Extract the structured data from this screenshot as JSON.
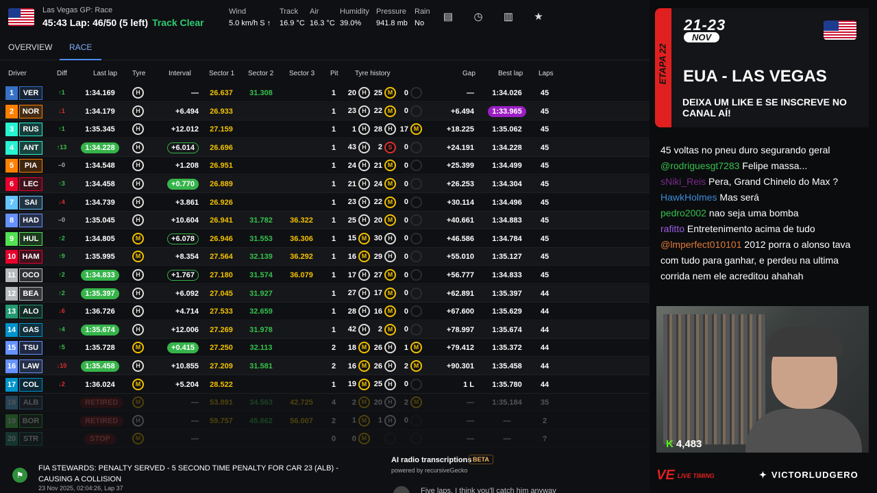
{
  "header": {
    "session": "Las Vegas GP: Race",
    "lap_line": "45:43 Lap: 46/50 (5 left)",
    "track_status": "Track Clear",
    "weather": [
      {
        "label": "Wind",
        "value": "5.0 km/h S ↑"
      },
      {
        "label": "Track",
        "value": "16.9 °C"
      },
      {
        "label": "Air",
        "value": "16.3 °C"
      },
      {
        "label": "Humidity",
        "value": "39.0%"
      },
      {
        "label": "Pressure",
        "value": "941.8 mb"
      },
      {
        "label": "Rain",
        "value": "No"
      }
    ]
  },
  "tabs": [
    {
      "label": "OVERVIEW"
    },
    {
      "label": "RACE",
      "active": true
    }
  ],
  "columns": {
    "driver": "Driver",
    "diff": "Diff",
    "last": "Last lap",
    "tyre": "Tyre",
    "interval": "Interval",
    "s1": "Sector 1",
    "s2": "Sector 2",
    "s3": "Sector 3",
    "pit": "Pit",
    "history": "Tyre history",
    "gap": "Gap",
    "best": "Best lap",
    "laps": "Laps"
  },
  "team_colors": {
    "VER": "#3671c6",
    "NOR": "#ff8000",
    "RUS": "#27f4d2",
    "ANT": "#27f4d2",
    "PIA": "#ff8000",
    "LEC": "#e8002d",
    "SAI": "#64c4ff",
    "HAD": "#6692ff",
    "HUL": "#52e252",
    "HAM": "#e8002d",
    "OCO": "#b6babd",
    "BEA": "#b6babd",
    "ALO": "#229971",
    "GAS": "#0093cc",
    "TSU": "#6692ff",
    "LAW": "#6692ff",
    "COL": "#0093cc",
    "ALB": "#64c4ff",
    "BOR": "#52e252",
    "STR": "#229971"
  },
  "rows": [
    {
      "pos": "1",
      "code": "VER",
      "diff": "↑1",
      "last": "1:34.169",
      "last_style": "",
      "tyre": "H",
      "interval": "—",
      "int_style": "",
      "s1": "26.637",
      "s2": "31.308",
      "s3": "",
      "pit": "1",
      "h": [
        [
          "20",
          "H"
        ],
        [
          "25",
          "M"
        ],
        [
          "0",
          ""
        ]
      ],
      "gap": "—",
      "best": "1:34.026",
      "best_style": "",
      "laps": "45"
    },
    {
      "pos": "2",
      "code": "NOR",
      "diff": "↓1",
      "last": "1:34.179",
      "last_style": "",
      "tyre": "H",
      "interval": "+6.494",
      "int_style": "",
      "s1": "26.933",
      "s2": "",
      "s3": "",
      "pit": "1",
      "h": [
        [
          "23",
          "H"
        ],
        [
          "22",
          "M"
        ],
        [
          "0",
          ""
        ]
      ],
      "gap": "+6.494",
      "best": "1:33.965",
      "best_style": "purple",
      "laps": "45"
    },
    {
      "pos": "3",
      "code": "RUS",
      "diff": "↑1",
      "last": "1:35.345",
      "last_style": "",
      "tyre": "H",
      "interval": "+12.012",
      "int_style": "",
      "s1": "27.159",
      "s2": "",
      "s3": "",
      "pit": "1",
      "h": [
        [
          "1",
          "H"
        ],
        [
          "28",
          "H"
        ],
        [
          "17",
          "M"
        ]
      ],
      "gap": "+18.225",
      "best": "1:35.062",
      "best_style": "",
      "laps": "45"
    },
    {
      "pos": "4",
      "code": "ANT",
      "diff": "↑13",
      "last": "1:34.228",
      "last_style": "green",
      "tyre": "H",
      "interval": "+6.014",
      "int_style": "ring",
      "s1": "26.696",
      "s2": "",
      "s3": "",
      "pit": "1",
      "h": [
        [
          "43",
          "H"
        ],
        [
          "2",
          "S"
        ],
        [
          "0",
          ""
        ]
      ],
      "gap": "+24.191",
      "best": "1:34.228",
      "best_style": "",
      "laps": "45"
    },
    {
      "pos": "5",
      "code": "PIA",
      "diff": "–0",
      "last": "1:34.548",
      "last_style": "",
      "tyre": "H",
      "interval": "+1.208",
      "int_style": "",
      "s1": "26.951",
      "s2": "",
      "s3": "",
      "pit": "1",
      "h": [
        [
          "24",
          "H"
        ],
        [
          "21",
          "M"
        ],
        [
          "0",
          ""
        ]
      ],
      "gap": "+25.399",
      "best": "1:34.499",
      "best_style": "",
      "laps": "45"
    },
    {
      "pos": "6",
      "code": "LEC",
      "diff": "↑3",
      "last": "1:34.458",
      "last_style": "",
      "tyre": "H",
      "interval": "+0.770",
      "int_style": "green",
      "s1": "26.889",
      "s2": "",
      "s3": "",
      "pit": "1",
      "h": [
        [
          "21",
          "H"
        ],
        [
          "24",
          "M"
        ],
        [
          "0",
          ""
        ]
      ],
      "gap": "+26.253",
      "best": "1:34.304",
      "best_style": "",
      "laps": "45"
    },
    {
      "pos": "7",
      "code": "SAI",
      "diff": "↓4",
      "last": "1:34.739",
      "last_style": "",
      "tyre": "H",
      "interval": "+3.861",
      "int_style": "",
      "s1": "26.926",
      "s2": "",
      "s3": "",
      "pit": "1",
      "h": [
        [
          "23",
          "H"
        ],
        [
          "22",
          "M"
        ],
        [
          "0",
          ""
        ]
      ],
      "gap": "+30.114",
      "best": "1:34.496",
      "best_style": "",
      "laps": "45"
    },
    {
      "pos": "8",
      "code": "HAD",
      "diff": "–0",
      "last": "1:35.045",
      "last_style": "",
      "tyre": "H",
      "interval": "+10.604",
      "int_style": "",
      "s1": "26.941",
      "s2": "31.782",
      "s3": "36.322",
      "pit": "1",
      "h": [
        [
          "25",
          "H"
        ],
        [
          "20",
          "M"
        ],
        [
          "0",
          ""
        ]
      ],
      "gap": "+40.661",
      "best": "1:34.883",
      "best_style": "",
      "laps": "45"
    },
    {
      "pos": "9",
      "code": "HUL",
      "diff": "↑2",
      "last": "1:34.805",
      "last_style": "",
      "tyre": "M",
      "interval": "+6.078",
      "int_style": "ring",
      "s1": "26.946",
      "s2": "31.553",
      "s3": "36.306",
      "pit": "1",
      "h": [
        [
          "15",
          "M"
        ],
        [
          "30",
          "H"
        ],
        [
          "0",
          ""
        ]
      ],
      "gap": "+46.586",
      "best": "1:34.784",
      "best_style": "",
      "laps": "45"
    },
    {
      "pos": "10",
      "code": "HAM",
      "diff": "↑9",
      "last": "1:35.995",
      "last_style": "",
      "tyre": "M",
      "interval": "+8.354",
      "int_style": "",
      "s1": "27.564",
      "s2": "32.139",
      "s3": "36.292",
      "pit": "1",
      "h": [
        [
          "16",
          "M"
        ],
        [
          "29",
          "H"
        ],
        [
          "0",
          ""
        ]
      ],
      "gap": "+55.010",
      "best": "1:35.127",
      "best_style": "",
      "laps": "45"
    },
    {
      "pos": "11",
      "code": "OCO",
      "diff": "↑2",
      "last": "1:34.833",
      "last_style": "green",
      "tyre": "H",
      "interval": "+1.767",
      "int_style": "ring",
      "s1": "27.180",
      "s2": "31.574",
      "s3": "36.079",
      "pit": "1",
      "h": [
        [
          "17",
          "H"
        ],
        [
          "27",
          "M"
        ],
        [
          "0",
          ""
        ]
      ],
      "gap": "+56.777",
      "best": "1:34.833",
      "best_style": "",
      "laps": "45"
    },
    {
      "pos": "12",
      "code": "BEA",
      "diff": "↑2",
      "last": "1:35.397",
      "last_style": "green",
      "tyre": "H",
      "interval": "+6.092",
      "int_style": "",
      "s1": "27.045",
      "s2": "31.927",
      "s3": "",
      "pit": "1",
      "h": [
        [
          "27",
          "H"
        ],
        [
          "17",
          "M"
        ],
        [
          "0",
          ""
        ]
      ],
      "gap": "+62.891",
      "best": "1:35.397",
      "best_style": "",
      "laps": "44"
    },
    {
      "pos": "13",
      "code": "ALO",
      "diff": "↓6",
      "last": "1:36.726",
      "last_style": "",
      "tyre": "H",
      "interval": "+4.714",
      "int_style": "",
      "s1": "27.533",
      "s2": "32.659",
      "s3": "",
      "pit": "1",
      "h": [
        [
          "28",
          "H"
        ],
        [
          "16",
          "M"
        ],
        [
          "0",
          ""
        ]
      ],
      "gap": "+67.600",
      "best": "1:35.629",
      "best_style": "",
      "laps": "44"
    },
    {
      "pos": "14",
      "code": "GAS",
      "diff": "↑4",
      "last": "1:35.674",
      "last_style": "green",
      "tyre": "H",
      "interval": "+12.006",
      "int_style": "",
      "s1": "27.269",
      "s2": "31.978",
      "s3": "",
      "pit": "1",
      "h": [
        [
          "42",
          "H"
        ],
        [
          "2",
          "M"
        ],
        [
          "0",
          ""
        ]
      ],
      "gap": "+78.997",
      "best": "1:35.674",
      "best_style": "",
      "laps": "44"
    },
    {
      "pos": "15",
      "code": "TSU",
      "diff": "↑5",
      "last": "1:35.728",
      "last_style": "",
      "tyre": "M",
      "interval": "+0.415",
      "int_style": "green",
      "s1": "27.250",
      "s2": "32.113",
      "s3": "",
      "pit": "2",
      "h": [
        [
          "18",
          "M"
        ],
        [
          "26",
          "H"
        ],
        [
          "1",
          "M"
        ]
      ],
      "gap": "+79.412",
      "best": "1:35.372",
      "best_style": "",
      "laps": "44"
    },
    {
      "pos": "16",
      "code": "LAW",
      "diff": "↓10",
      "last": "1:35.458",
      "last_style": "green",
      "tyre": "H",
      "interval": "+10.855",
      "int_style": "",
      "s1": "27.209",
      "s2": "31.581",
      "s3": "",
      "pit": "2",
      "h": [
        [
          "16",
          "M"
        ],
        [
          "26",
          "H"
        ],
        [
          "2",
          "M"
        ]
      ],
      "gap": "+90.301",
      "best": "1:35.458",
      "best_style": "",
      "laps": "44"
    },
    {
      "pos": "17",
      "code": "COL",
      "diff": "↓2",
      "last": "1:36.024",
      "last_style": "",
      "tyre": "M",
      "interval": "+5.204",
      "int_style": "",
      "s1": "28.522",
      "s2": "",
      "s3": "",
      "pit": "1",
      "h": [
        [
          "19",
          "M"
        ],
        [
          "25",
          "H"
        ],
        [
          "0",
          ""
        ]
      ],
      "gap": "1 L",
      "best": "1:35.780",
      "best_style": "",
      "laps": "44"
    },
    {
      "pos": "18",
      "code": "ALB",
      "diff": "",
      "last": "RETIRED",
      "last_style": "ret",
      "tyre": "M",
      "interval": "—",
      "int_style": "",
      "s1": "53.891",
      "s2": "34.563",
      "s3": "42.725",
      "pit": "4",
      "h": [
        [
          "2",
          "M"
        ],
        [
          "20",
          "H"
        ],
        [
          "2",
          "M"
        ]
      ],
      "gap": "—",
      "best": "1:35.184",
      "best_style": "",
      "laps": "35",
      "dim": true
    },
    {
      "pos": "19",
      "code": "BOR",
      "diff": "",
      "last": "RETIRED",
      "last_style": "ret",
      "tyre": "H",
      "interval": "—",
      "int_style": "",
      "s1": "59.757",
      "s2": "45.862",
      "s3": "56.007",
      "pit": "2",
      "h": [
        [
          "1",
          "M"
        ],
        [
          "1",
          "H"
        ],
        [
          "0",
          ""
        ]
      ],
      "gap": "—",
      "best": "—",
      "best_style": "",
      "laps": "2",
      "dim": true
    },
    {
      "pos": "20",
      "code": "STR",
      "diff": "",
      "last": "STOP",
      "last_style": "ret",
      "tyre": "M",
      "interval": "—",
      "int_style": "",
      "s1": "",
      "s2": "",
      "s3": "",
      "pit": "0",
      "h": [
        [
          "0",
          "M"
        ],
        [
          "",
          ""
        ],
        [
          "",
          ""
        ]
      ],
      "gap": "—",
      "best": "—",
      "best_style": "",
      "laps": "?",
      "dim": true
    }
  ],
  "ticker": {
    "message": "FIA STEWARDS: PENALTY SERVED - 5 SECOND TIME PENALTY FOR CAR 23 (ALB) - CAUSING A COLLISION",
    "time": "23 Nov 2025, 02:04:26, Lap 37",
    "radio_title": "AI radio transcriptions",
    "radio_badge": "BETA",
    "radio_powered": "powered by recursiveGecko",
    "radio_snippet": "Five laps. I think you'll catch him anyway"
  },
  "overlay": {
    "stage": "ETAPA 22",
    "dates": "21-23",
    "month": "NOV",
    "event": "EUA - LAS VEGAS",
    "cta": "DEIXA UM LIKE E SE INSCREVE NO CANAL AÍ!",
    "chat": [
      {
        "user": "",
        "text": "45 voltas no pneu duro segurando geral",
        "color": "#ffffff"
      },
      {
        "user": "@rodriguesgt7283",
        "text": "Felipe massa...",
        "color": "#35c24d"
      },
      {
        "user": "sNiki_Reis",
        "text": "Pera, Grand Chinelo do Max ?",
        "color": "#7a2a8a"
      },
      {
        "user": "HawkHolmes",
        "text": "Mas será",
        "color": "#3d8bd6"
      },
      {
        "user": "pedro2002",
        "text": "nao seja uma bomba",
        "color": "#35c24d"
      },
      {
        "user": "rafitto",
        "text": "Entretenimento acima de tudo",
        "color": "#9b5de5"
      },
      {
        "user": "@lmperfect010101",
        "text": "2012 porra o alonso tava com tudo para ganhar, e perdeu na ultima corrida nem ele acreditou ahahah",
        "color": "#e07a3a"
      }
    ],
    "viewers": "4,483",
    "brand": "LIVE TIMING",
    "twitter": "VICTORLUDGERO"
  }
}
